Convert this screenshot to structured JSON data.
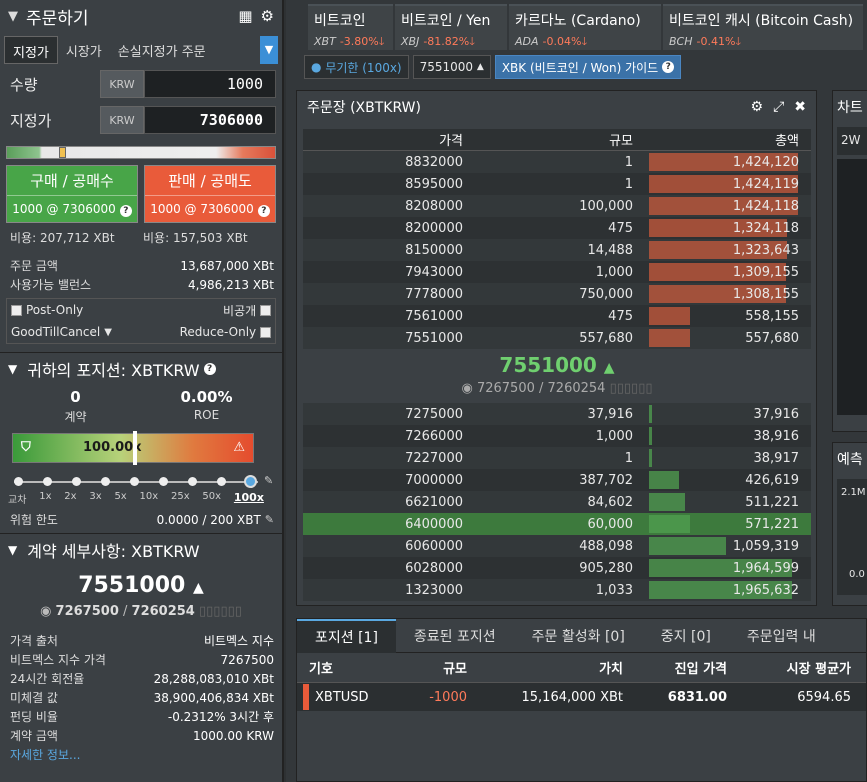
{
  "order": {
    "title": "주문하기",
    "tabs": [
      "지정가",
      "시장가",
      "손실지정가 주문"
    ],
    "qty_label": "수량",
    "qty_currency": "KRW",
    "qty_value": "1000",
    "price_label": "지정가",
    "price_currency": "KRW",
    "price_value": "7306000",
    "buy_label": "구매 / 공매수",
    "buy_sub": "1000 @ 7306000",
    "sell_label": "판매 / 공매도",
    "sell_sub": "1000 @ 7306000",
    "buy_cost": "비용: 207,712 XBt",
    "sell_cost": "비용: 157,503 XBt",
    "order_value_label": "주문 금액",
    "order_value": "13,687,000 XBt",
    "avail_label": "사용가능 밸런스",
    "avail_value": "4,986,213 XBt",
    "post_only": "Post-Only",
    "hidden": "비공개",
    "tif": "GoodTillCancel",
    "reduce_only": "Reduce-Only"
  },
  "position": {
    "title": "귀하의 포지션: XBTKRW",
    "contracts": "0",
    "contracts_label": "계약",
    "roe": "0.00%",
    "roe_label": "ROE",
    "leverage": "100.00x",
    "ticks": [
      "교차",
      "1x",
      "2x",
      "3x",
      "5x",
      "10x",
      "25x",
      "50x",
      "100x"
    ],
    "risk_label": "위험 한도",
    "risk_value": "0.0000 / 200 XBT"
  },
  "contract": {
    "title": "계약 세부사항: XBTKRW",
    "price": "7551000",
    "index_price": "7267500",
    "fair_price": "7260254",
    "rows": [
      {
        "k": "가격 출처",
        "v": "비트멕스 지수"
      },
      {
        "k": "비트멕스 지수 가격",
        "v": "7267500"
      },
      {
        "k": "24시간 회전율",
        "v": "28,288,083,010 XBt"
      },
      {
        "k": "미체결 값",
        "v": "38,900,406,834 XBt"
      },
      {
        "k": "펀딩 비율",
        "v": "-0.2312% 3시간 후"
      },
      {
        "k": "계약 금액",
        "v": "1000.00 KRW"
      }
    ],
    "more": "자세한 정보..."
  },
  "tickers": [
    {
      "name": "비트코인",
      "sym": "XBT",
      "chg": "-3.80%"
    },
    {
      "name": "비트코인 / Yen",
      "sym": "XBJ",
      "chg": "-81.82%"
    },
    {
      "name": "카르다노 (Cardano)",
      "sym": "ADA",
      "chg": "-0.04%"
    },
    {
      "name": "비트코인 캐시 (Bitcoin Cash)",
      "sym": "BCH",
      "chg": "-0.41%"
    }
  ],
  "toolbar": {
    "leverage": "무기한 (100x)",
    "price": "7551000",
    "guide": "XBK (비트코인 / Won) 가이드"
  },
  "orderbook": {
    "title": "주문장 (XBTKRW)",
    "headers": [
      "가격",
      "규모",
      "총액"
    ],
    "asks": [
      {
        "price": "8832000",
        "size": "1",
        "total": "1,424,120",
        "pct": 0.99
      },
      {
        "price": "8595000",
        "size": "1",
        "total": "1,424,119",
        "pct": 0.99
      },
      {
        "price": "8208000",
        "size": "100,000",
        "total": "1,424,118",
        "pct": 0.99
      },
      {
        "price": "8200000",
        "size": "475",
        "total": "1,324,118",
        "pct": 0.92
      },
      {
        "price": "8150000",
        "size": "14,488",
        "total": "1,323,643",
        "pct": 0.92
      },
      {
        "price": "7943000",
        "size": "1,000",
        "total": "1,309,155",
        "pct": 0.91
      },
      {
        "price": "7778000",
        "size": "750,000",
        "total": "1,308,155",
        "pct": 0.91
      },
      {
        "price": "7561000",
        "size": "475",
        "total": "558,155",
        "pct": 0.27
      },
      {
        "price": "7551000",
        "size": "557,680",
        "total": "557,680",
        "pct": 0.27
      }
    ],
    "mid_price": "7551000",
    "mid_index": "7267500",
    "mid_fair": "7260254",
    "bids": [
      {
        "price": "7275000",
        "size": "37,916",
        "total": "37,916",
        "pct": 0.02
      },
      {
        "price": "7266000",
        "size": "1,000",
        "total": "38,916",
        "pct": 0.02
      },
      {
        "price": "7227000",
        "size": "1",
        "total": "38,917",
        "pct": 0.02
      },
      {
        "price": "7000000",
        "size": "387,702",
        "total": "426,619",
        "pct": 0.2
      },
      {
        "price": "6621000",
        "size": "84,602",
        "total": "511,221",
        "pct": 0.24
      },
      {
        "price": "6400000",
        "size": "60,000",
        "total": "571,221",
        "pct": 0.27
      },
      {
        "price": "6060000",
        "size": "488,098",
        "total": "1,059,319",
        "pct": 0.51
      },
      {
        "price": "6028000",
        "size": "905,280",
        "total": "1,964,599",
        "pct": 0.95
      },
      {
        "price": "1323000",
        "size": "1,033",
        "total": "1,965,632",
        "pct": 0.95
      }
    ]
  },
  "chart_panel": {
    "title": "차트",
    "tf": "2W"
  },
  "predict_panel": {
    "title": "예측",
    "ylabel": "2.1M",
    "ylabel2": "0.0"
  },
  "bottom": {
    "tabs": [
      "포지션 [1]",
      "종료된 포지션",
      "주문 활성화 [0]",
      "중지 [0]",
      "주문입력 내"
    ],
    "headers": [
      "기호",
      "규모",
      "가치",
      "진입 가격",
      "시장 평균가"
    ],
    "row": {
      "sym": "XBTUSD",
      "size": "-1000",
      "value": "15,164,000 XBt",
      "entry": "6831.00",
      "mark": "6594.65"
    }
  }
}
